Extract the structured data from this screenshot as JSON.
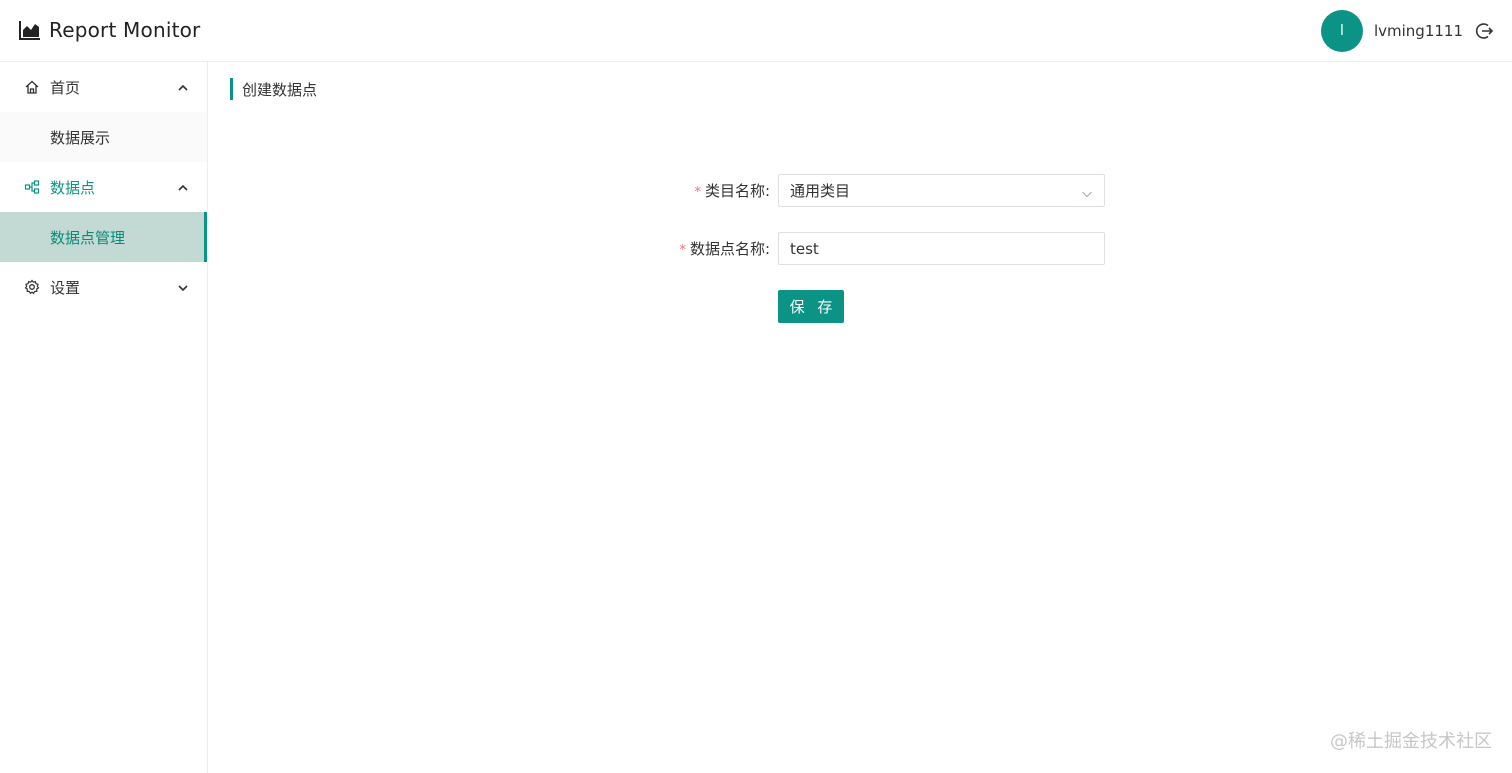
{
  "header": {
    "title": "Report Monitor",
    "brand_icon": "area-chart-icon",
    "user": {
      "avatar_letter": "l",
      "name": "lvming1111",
      "logout_icon": "logout-icon"
    }
  },
  "sidebar": {
    "groups": [
      {
        "label": "首页",
        "icon": "home-icon",
        "expanded": true,
        "items": [
          "数据展示"
        ]
      },
      {
        "label": "数据点",
        "icon": "nodes-icon",
        "expanded": true,
        "active": true,
        "items": [
          "数据点管理"
        ]
      },
      {
        "label": "设置",
        "icon": "gear-icon",
        "expanded": false,
        "items": []
      }
    ]
  },
  "main": {
    "page_title": "创建数据点",
    "form": {
      "required_mark": "*",
      "category_label": "类目名称:",
      "category_value": "通用类目",
      "datapoint_label": "数据点名称:",
      "datapoint_value": "test",
      "save_label": "保 存"
    }
  },
  "watermark": "@稀土掘金技术社区",
  "colors": {
    "accent": "#0b9485",
    "selected_bg": "#c2dad3",
    "required": "#f56c6c"
  }
}
